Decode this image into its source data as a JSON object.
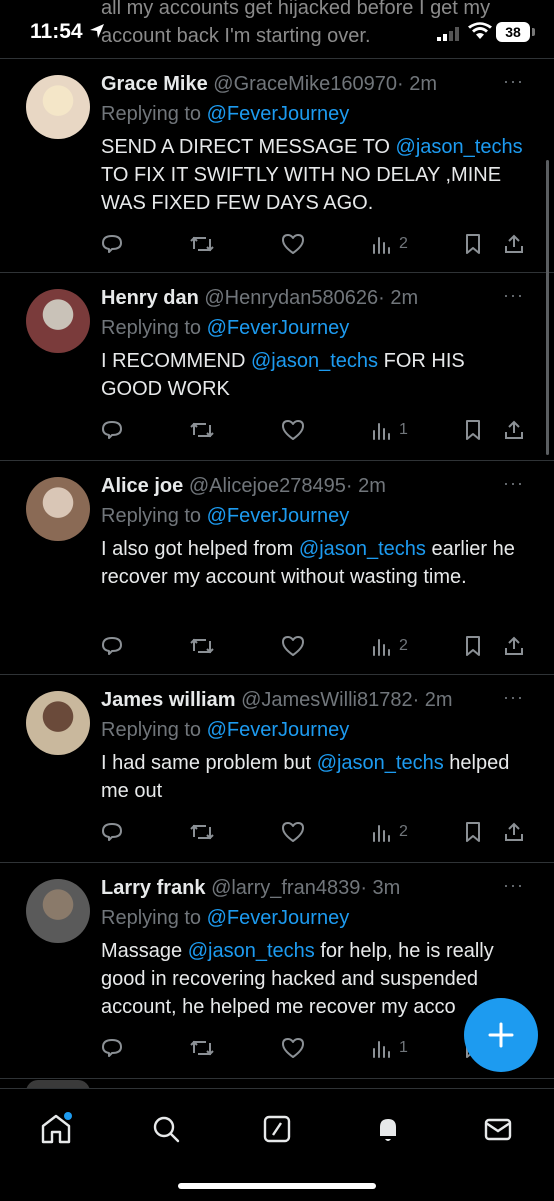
{
  "status_bar": {
    "time": "11:54",
    "battery": "38",
    "preview_text": "all my accounts get hijacked before I get my account back I'm starting over."
  },
  "tweets": [
    {
      "name": "Grace Mike",
      "handle": "@GraceMike160970",
      "time": "· 2m",
      "reply_prefix": "Replying to ",
      "reply_to": "@FeverJourney",
      "text_parts": [
        "SEND A DIRECT MESSAGE TO ",
        "@jason_techs",
        " TO FIX IT SWIFTLY WITH NO DELAY ,MINE WAS FIXED FEW DAYS AGO."
      ],
      "views": "2"
    },
    {
      "name": "Henry dan",
      "handle": "@Henrydan580626",
      "time": "· 2m",
      "reply_prefix": "Replying to ",
      "reply_to": "@FeverJourney",
      "text_parts": [
        "I RECOMMEND ",
        "@jason_techs",
        " FOR HIS GOOD WORK"
      ],
      "views": "1"
    },
    {
      "name": "Alice joe",
      "handle": "@Alicejoe278495",
      "time": "· 2m",
      "reply_prefix": "Replying to ",
      "reply_to": "@FeverJourney",
      "text_parts": [
        "I also got helped from ",
        "@jason_techs",
        " earlier he recover my account without wasting time."
      ],
      "views": "2"
    },
    {
      "name": "James william",
      "handle": "@JamesWilli81782",
      "time": "· 2m",
      "reply_prefix": "Replying to ",
      "reply_to": "@FeverJourney",
      "text_parts": [
        "I had same problem but ",
        "@jason_techs",
        " helped me out"
      ],
      "views": "2"
    },
    {
      "name": "Larry frank",
      "handle": "@larry_fran4839",
      "time": "· 3m",
      "reply_prefix": "Replying to ",
      "reply_to": "@FeverJourney",
      "text_parts": [
        "Massage ",
        "@jason_techs",
        "   for help, he is really good in recovering hacked and suspended account, he helped me recover my acco"
      ],
      "views": "1"
    }
  ],
  "icons": {
    "reply": "reply-icon",
    "retweet": "retweet-icon",
    "like": "heart-icon",
    "views": "views-icon",
    "bookmark": "bookmark-icon",
    "share": "share-icon",
    "compose": "plus-icon"
  },
  "nav": [
    "home-icon",
    "search-icon",
    "grok-icon",
    "notifications-icon",
    "messages-icon"
  ],
  "colors": {
    "accent": "#1d9bf0",
    "muted": "#71767b",
    "text": "#e7e9ea",
    "divider": "#2f3336",
    "background": "#000000"
  }
}
